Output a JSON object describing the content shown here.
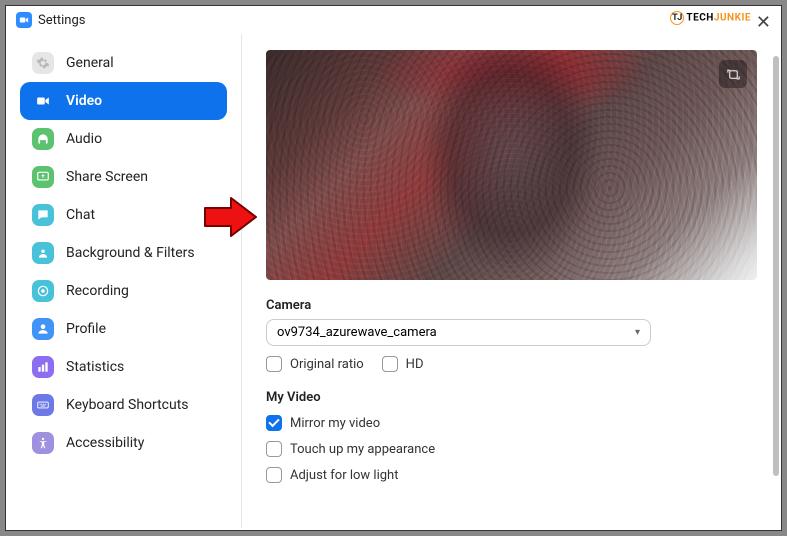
{
  "watermark": {
    "brand1": "TECH",
    "brand2": "JUNKIE",
    "icon": "TJ"
  },
  "window": {
    "title": "Settings"
  },
  "sidebar": {
    "items": [
      {
        "label": "General"
      },
      {
        "label": "Video"
      },
      {
        "label": "Audio"
      },
      {
        "label": "Share Screen"
      },
      {
        "label": "Chat"
      },
      {
        "label": "Background & Filters"
      },
      {
        "label": "Recording"
      },
      {
        "label": "Profile"
      },
      {
        "label": "Statistics"
      },
      {
        "label": "Keyboard Shortcuts"
      },
      {
        "label": "Accessibility"
      }
    ]
  },
  "main": {
    "camera_label": "Camera",
    "camera_selected": "ov9734_azurewave_camera",
    "original_ratio": "Original ratio",
    "hd": "HD",
    "myvideo_label": "My Video",
    "mirror": "Mirror my video",
    "touchup": "Touch up my appearance",
    "lowlight": "Adjust for low light"
  }
}
